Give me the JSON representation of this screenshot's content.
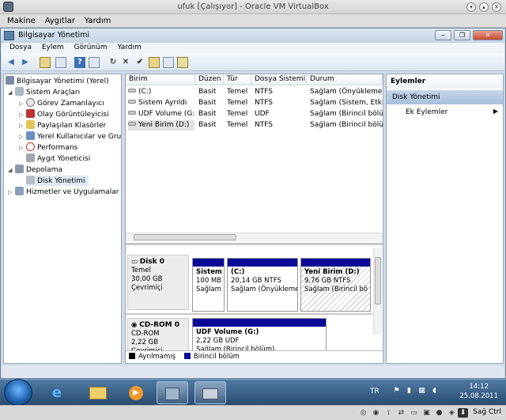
{
  "vbox": {
    "title": "ufuk [Çalışıyor] - Oracle VM VirtualBox",
    "menu": [
      "Makine",
      "Aygıtlar",
      "Yardım"
    ],
    "host_key": "Sağ Ctrl"
  },
  "mmc": {
    "title": "Bilgisayar Yönetimi",
    "menu": [
      "Dosya",
      "Eylem",
      "Görünüm",
      "Yardım"
    ],
    "tree": {
      "root": "Bilgisayar Yönetimi (Yerel)",
      "system_tools": "Sistem Araçları",
      "task_scheduler": "Görev Zamanlayıcı",
      "event_viewer": "Olay Görüntüleyicisi",
      "shared_folders": "Paylaşılan Klasörler",
      "local_users": "Yerel Kullanıcılar ve Gru",
      "performance": "Performans",
      "device_manager": "Aygıt Yöneticisi",
      "storage": "Depolama",
      "disk_management": "Disk Yönetimi",
      "services_apps": "Hizmetler ve Uygulamalar"
    },
    "volume_table": {
      "columns": [
        "Birim",
        "Düzen",
        "Tür",
        "Dosya Sistemi",
        "Durum"
      ],
      "rows": [
        [
          "(C:)",
          "Basit",
          "Temel",
          "NTFS",
          "Sağlam (Önyükleme, D"
        ],
        [
          "Sistem Ayrıldı",
          "Basit",
          "Temel",
          "NTFS",
          "Sağlam (Sistem, Etkin,"
        ],
        [
          "UDF Volume (G:)",
          "Basit",
          "Temel",
          "UDF",
          "Sağlam (Birincil bölüm"
        ],
        [
          "Yeni Birim (D:)",
          "Basit",
          "Temel",
          "NTFS",
          "Sağlam (Birincil bölüm"
        ]
      ]
    },
    "disks": [
      {
        "name": "Disk 0",
        "type": "Temel",
        "size": "30,00 GB",
        "status": "Çevrimiçi",
        "partitions": [
          {
            "name": "Sistem",
            "size": "100 MB",
            "status": "Sağlam"
          },
          {
            "name": "(C:)",
            "size": "20,14 GB NTFS",
            "status": "Sağlam (Önyükleme"
          },
          {
            "name": "Yeni Birim  (D:)",
            "size": "9,76 GB NTFS",
            "status": "Sağlam (Birincil bö"
          }
        ]
      },
      {
        "name": "CD-ROM 0",
        "type": "CD-ROM",
        "size": "2,22 GB",
        "status": "Çevrimiçi",
        "partitions": [
          {
            "name": "UDF Volume  (G:)",
            "size": "2,22 GB UDF",
            "status": "Sağlam (Birincil bölüm)"
          }
        ]
      }
    ],
    "legend": [
      {
        "label": "Ayrılmamış",
        "color": "#000000"
      },
      {
        "label": "Birincil bölüm",
        "color": "#0a0a96"
      }
    ],
    "actions": {
      "header": "Eylemler",
      "group": "Disk Yönetimi",
      "item": "Ek Eylemler"
    }
  },
  "taskbar": {
    "lang": "TR",
    "time": "14:12",
    "date": "25.08.2011"
  }
}
